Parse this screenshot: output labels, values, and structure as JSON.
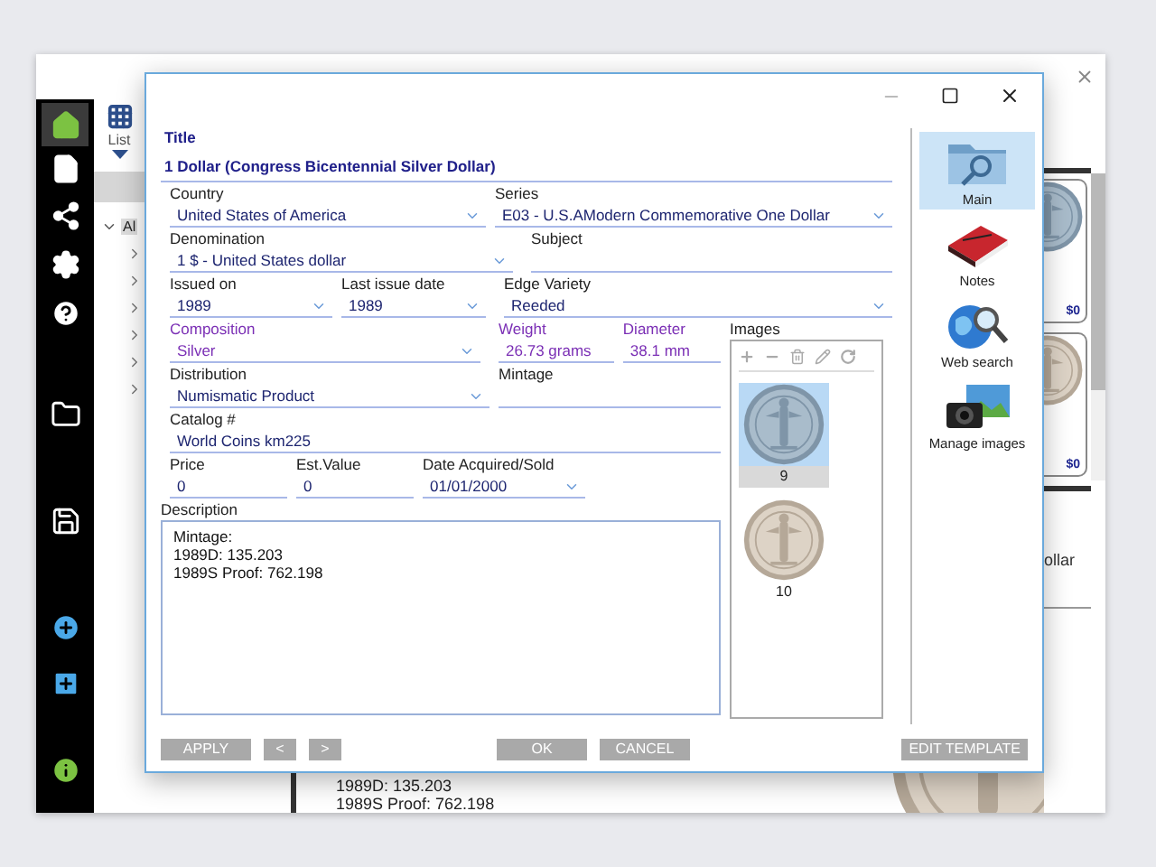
{
  "app": {
    "sidebar": [
      {
        "selected": true
      },
      {
        "selected": false
      },
      {
        "selected": false
      },
      {
        "selected": false
      },
      {
        "selected": false
      },
      {
        "selected": false
      },
      {
        "selected": false
      },
      {
        "selected": false
      },
      {
        "selected": false
      },
      {
        "selected": false
      }
    ],
    "toolbar": {
      "view_label": "List"
    },
    "tree": [
      {
        "label": "Al",
        "expanded": true,
        "children": [
          {
            "expanded": false
          },
          {
            "expanded": false
          },
          {
            "expanded": false
          },
          {
            "expanded": false
          },
          {
            "expanded": false
          },
          {
            "expanded": false
          }
        ]
      }
    ],
    "cards": [
      {
        "price": "$0"
      },
      {
        "price": "$0"
      }
    ],
    "side_text": "ollar",
    "description": "1989D: 135.203\n1989S Proof: 762.198"
  },
  "dialog": {
    "title": {
      "label": "Title",
      "value": "1 Dollar (Congress Bicentennial Silver Dollar)"
    },
    "top_rows": [
      [
        {
          "label": "Country",
          "value": "United States of America",
          "kind": "dropdown",
          "accent": false
        },
        {
          "label": "Series",
          "value": "E03 - U.S.AModern Commemorative One Dollar",
          "kind": "dropdown",
          "accent": false
        }
      ],
      [
        {
          "label": "Denomination",
          "value": "1 $ - United States dollar",
          "kind": "dropdown",
          "accent": false
        },
        {
          "label": "Subject",
          "kind": "text",
          "accent": false
        }
      ],
      [
        {
          "label": "Issued on",
          "value": "1989",
          "kind": "dropdown",
          "accent": false
        },
        {
          "label": "Last issue date",
          "value": "1989",
          "kind": "dropdown",
          "accent": false
        },
        {
          "label": "Edge Variety",
          "value": "Reeded",
          "kind": "dropdown",
          "accent": false
        }
      ]
    ],
    "left_rows": [
      [
        {
          "label": "Composition",
          "value": "Silver",
          "kind": "dropdown",
          "accent": true
        },
        {
          "label": "Weight",
          "value": "26.73 grams",
          "kind": "text",
          "accent": true
        },
        {
          "label": "Diameter",
          "value": "38.1 mm",
          "kind": "text",
          "accent": true
        }
      ],
      [
        {
          "label": "Distribution",
          "value": "Numismatic Product",
          "kind": "dropdown",
          "accent": false
        },
        {
          "label": "Mintage",
          "kind": "text",
          "accent": false
        }
      ],
      [
        {
          "label": "Catalog #",
          "value": "World Coins km225",
          "kind": "text",
          "accent": false
        }
      ],
      [
        {
          "label": "Price",
          "value": "0",
          "kind": "text",
          "accent": false
        },
        {
          "label": "Est.Value",
          "value": "0",
          "kind": "text",
          "accent": false
        },
        {
          "label": "Date Acquired/Sold",
          "value": "01/01/2000",
          "kind": "dropdown",
          "accent": false
        }
      ]
    ],
    "description": {
      "label": "Description",
      "value": "Mintage:\n1989D: 135.203\n1989S Proof: 762.198"
    },
    "images": {
      "label": "Images",
      "items": [
        {
          "caption": "9",
          "selected": true
        },
        {
          "caption": "10",
          "selected": false
        }
      ]
    },
    "buttons_left": [
      "APPLY",
      "<",
      ">"
    ],
    "buttons_center": [
      "OK",
      "CANCEL"
    ],
    "buttons_right": [
      "EDIT TEMPLATE"
    ],
    "nav": [
      {
        "label": "Main",
        "selected": true
      },
      {
        "label": "Notes",
        "selected": false
      },
      {
        "label": "Web search",
        "selected": false
      },
      {
        "label": "Manage images",
        "selected": false
      }
    ]
  }
}
